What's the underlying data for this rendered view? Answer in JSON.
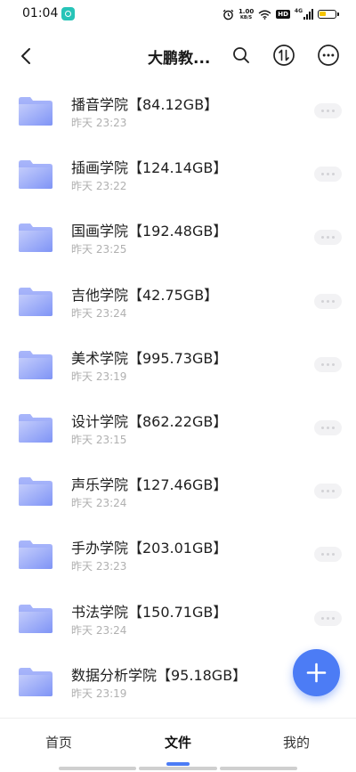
{
  "status": {
    "time": "01:04",
    "net_speed_value": "1.00",
    "net_speed_unit": "KB/S",
    "hd": "HD",
    "net_type": "4G"
  },
  "header": {
    "title": "大鹏教..."
  },
  "files": [
    {
      "name": "播音学院【84.12GB】",
      "time": "昨天 23:23"
    },
    {
      "name": "插画学院【124.14GB】",
      "time": "昨天 23:22"
    },
    {
      "name": "国画学院【192.48GB】",
      "time": "昨天 23:25"
    },
    {
      "name": "吉他学院【42.75GB】",
      "time": "昨天 23:24"
    },
    {
      "name": "美术学院【995.73GB】",
      "time": "昨天 23:19"
    },
    {
      "name": "设计学院【862.22GB】",
      "time": "昨天 23:15"
    },
    {
      "name": "声乐学院【127.46GB】",
      "time": "昨天 23:24"
    },
    {
      "name": "手办学院【203.01GB】",
      "time": "昨天 23:23"
    },
    {
      "name": "书法学院【150.71GB】",
      "time": "昨天 23:24"
    },
    {
      "name": "数据分析学院【95.18GB】",
      "time": "昨天 23:19"
    }
  ],
  "tabs": [
    {
      "label": "首页"
    },
    {
      "label": "文件"
    },
    {
      "label": "我的"
    }
  ],
  "active_tab": "文件",
  "colors": {
    "accent": "#4c7cf5",
    "folder_top": "#b3c0fb",
    "folder_bottom": "#7f94f6"
  },
  "icons": [
    "back-arrow-icon",
    "search-icon",
    "sort-icon",
    "more-icon",
    "folder-icon",
    "plus-icon",
    "alarm-icon",
    "wifi-icon",
    "signal-icon",
    "battery-icon"
  ]
}
